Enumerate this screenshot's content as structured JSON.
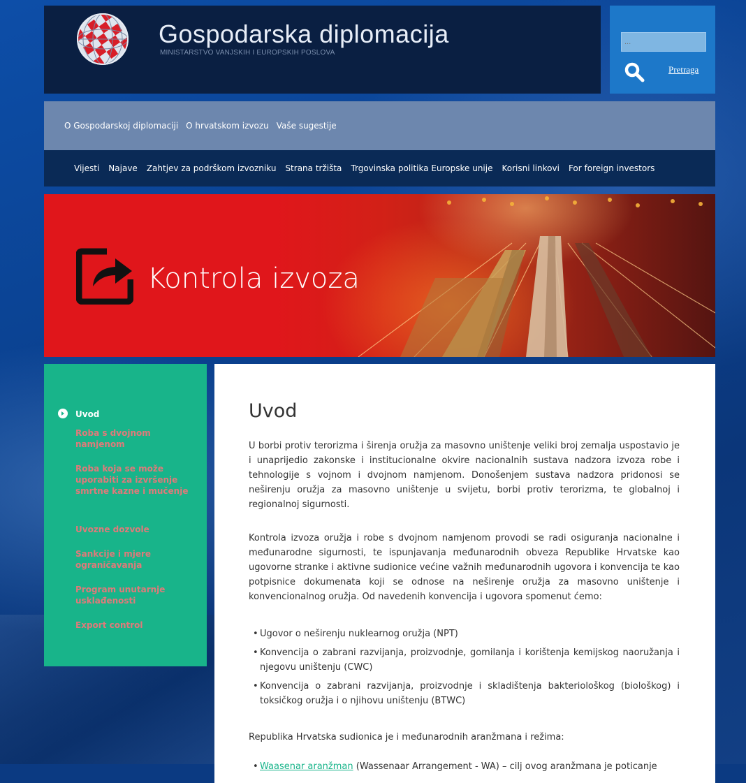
{
  "header": {
    "title": "Gospodarska diplomacija",
    "subtitle": "MINISTARSTVO VANJSKIH I EUROPSKIH POSLOVA",
    "search_placeholder": "...",
    "search_label": "Pretraga"
  },
  "nav_primary": [
    {
      "label": "O Gospodarskoj diplomaciji"
    },
    {
      "label": "O hrvatskom izvozu"
    },
    {
      "label": "Vaše sugestije"
    }
  ],
  "nav_secondary": [
    {
      "label": "Vijesti"
    },
    {
      "label": "Najave"
    },
    {
      "label": "Zahtjev za podrškom izvozniku"
    },
    {
      "label": "Strana tržišta"
    },
    {
      "label": "Trgovinska politika Europske unije"
    },
    {
      "label": "Korisni linkovi"
    },
    {
      "label": "For foreign investors"
    }
  ],
  "banner": {
    "title": "Kontrola izvoza"
  },
  "sidebar": {
    "items": [
      {
        "label": "Uvod"
      },
      {
        "label": "Roba s dvojnom namjenom"
      },
      {
        "label": "Roba koja se može uporabiti za izvršenje smrtne kazne i mučenje"
      },
      {
        "label": "Uvozne dozvole"
      },
      {
        "label": "Sankcije i mjere ograničavanja"
      },
      {
        "label": "Program unutarnje usklađenosti"
      },
      {
        "label": "Export control"
      }
    ]
  },
  "content": {
    "heading": "Uvod",
    "p1": "U borbi protiv terorizma i širenja oružja za masovno uništenje veliki broj zemalja uspostavio je i unaprijedio zakonske i institucionalne okvire nacionalnih sustava nadzora izvoza robe i tehnologije s vojnom i dvojnom namjenom. Donošenjem sustava nadzora pridonosi se neširenju oružja za masovno uništenje u svijetu, borbi protiv terorizma, te globalnoj i regionalnoj sigurnosti.",
    "p2": "Kontrola izvoza oružja i robe s dvojnom namjenom provodi se radi osiguranja nacionalne i međunarodne sigurnosti, te ispunjavanja međunarodnih obveza Republike Hrvatske kao ugovorne stranke i aktivne sudionice većine važnih međunarodnih ugovora i konvencija te kao potpisnice dokumenata koji se odnose na neširenje oružja za masovno uništenje i konvencionalnog oružja. Od navedenih konvencija i ugovora spomenut ćemo:",
    "list1": [
      "Ugovor o neširenju nuklearnog oružja (NPT)",
      "Konvencija o zabrani razvijanja, proizvodnje, gomilanja i korištenja kemijskog naoružanja i njegovu uništenju (CWC)",
      "Konvencija o zabrani razvijanja, proizvodnje i skladištenja bakteriološkog (biološkog) i toksičkog oružja i o njihovu uništenju (BTWC)"
    ],
    "p3": "Republika Hrvatska sudionica je i međunarodnih aranžmana i režima:",
    "list2_link": "Waasenar aranžman",
    "list2_rest": " (Wassenaar Arrangement - WA) – cilj ovog aranžmana je poticanje"
  },
  "colors": {
    "header_bg": "#0a1f42",
    "search_bg": "#1d78c9",
    "nav1_bg": "#6d87ae",
    "nav2_bg": "#0a2a56",
    "banner_red": "#e0161b",
    "sidebar_green": "#18b48a",
    "sidebar_link": "#e07a7a",
    "link_green": "#18b48a"
  }
}
